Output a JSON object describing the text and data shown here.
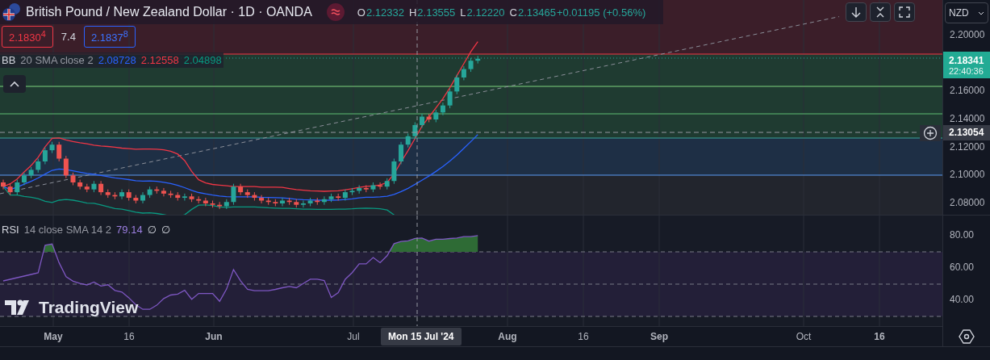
{
  "header": {
    "title": "British Pound / New Zealand Dollar · 1D · OANDA",
    "ohlc": [
      {
        "label": "O",
        "value": "2.12332"
      },
      {
        "label": "H",
        "value": "2.13555"
      },
      {
        "label": "L",
        "value": "2.12220"
      },
      {
        "label": "C",
        "value": "2.13465"
      }
    ],
    "change": "+0.01195 (+0.56%)"
  },
  "trade": {
    "sell": "2.1830$^{4}$",
    "spread": "7.4",
    "buy": "2.1837$^{8}$"
  },
  "bb_legend": {
    "name": "BB",
    "params": "20 SMA close 2",
    "values": [
      {
        "text": "2.08728",
        "color": "#2962ff"
      },
      {
        "text": "2.12558",
        "color": "#f23645"
      },
      {
        "text": "2.04898",
        "color": "#089981"
      }
    ]
  },
  "price_axis": {
    "currency": "NZD",
    "ticks": [
      "2.20000",
      "2.16000",
      "2.14000",
      "2.12000",
      "2.10000",
      "2.08000"
    ],
    "last_price": "2.18341",
    "countdown": "22:40:36",
    "crosshair_price": "2.13054"
  },
  "rsi_legend": {
    "name": "RSI",
    "params": "14 close SMA 14 2",
    "value": "79.14",
    "extra": [
      "∅",
      "∅"
    ]
  },
  "rsi_axis": {
    "ticks": [
      "80.00",
      "60.00",
      "40.00"
    ]
  },
  "logo": "TradingView",
  "time_axis": {
    "ticks": [
      "May",
      "16",
      "Jun",
      "Jul",
      "Aug",
      "16",
      "Sep",
      "Oct",
      "16"
    ],
    "crosshair_label": "Mon 15 Jul '24"
  }
}
